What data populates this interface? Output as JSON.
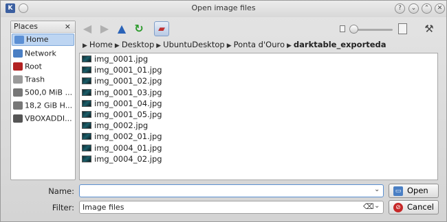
{
  "window": {
    "title": "Open image files",
    "buttons": [
      "?",
      "⌄",
      "⌃",
      "✕"
    ]
  },
  "places": {
    "header": "Places",
    "items": [
      {
        "label": "Home",
        "icon": "home-folder-icon",
        "color": "#5b8fd4",
        "selected": true
      },
      {
        "label": "Network",
        "icon": "network-icon",
        "color": "#4a7fc4",
        "selected": false
      },
      {
        "label": "Root",
        "icon": "root-folder-icon",
        "color": "#b22222",
        "selected": false
      },
      {
        "label": "Trash",
        "icon": "trash-icon",
        "color": "#9a9a9a",
        "selected": false
      },
      {
        "label": "500,0 MiB ...",
        "icon": "drive-icon",
        "color": "#777777",
        "selected": false
      },
      {
        "label": "18,2 GiB H...",
        "icon": "drive-icon",
        "color": "#777777",
        "selected": false
      },
      {
        "label": "VBOXADDI...",
        "icon": "cdrom-icon",
        "color": "#555555",
        "selected": false
      }
    ]
  },
  "breadcrumb": [
    "Home",
    "Desktop",
    "UbuntuDesktop",
    "Ponta d'Ouro",
    "darktable_exporteda"
  ],
  "files": [
    "img_0001.jpg",
    "img_0001_01.jpg",
    "img_0001_02.jpg",
    "img_0001_03.jpg",
    "img_0001_04.jpg",
    "img_0001_05.jpg",
    "img_0002.jpg",
    "img_0002_01.jpg",
    "img_0004_01.jpg",
    "img_0004_02.jpg"
  ],
  "name_field": {
    "label": "Name:",
    "value": ""
  },
  "filter_field": {
    "label": "Filter:",
    "value": "Image files"
  },
  "open_button": "Open",
  "cancel_button": "Cancel",
  "colors": {
    "accent": "#bdd5f2",
    "open_icon": "#4a7fc4",
    "cancel_icon": "#c62828"
  }
}
